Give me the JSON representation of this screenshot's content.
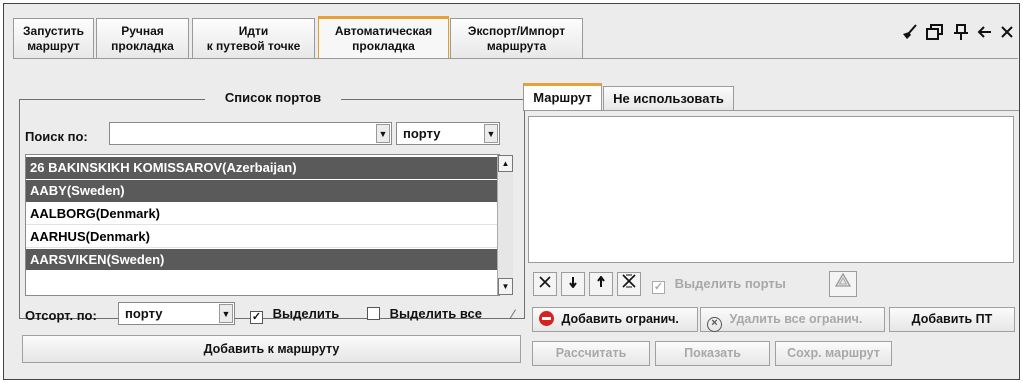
{
  "tabs": [
    {
      "label": "Запустить\nмаршрут"
    },
    {
      "label": "Ручная\nпрокладка"
    },
    {
      "label": "Идти\nк путевой точке"
    },
    {
      "label": "Автоматическая\nпрокладка"
    },
    {
      "label": "Экспорт/Импорт\nмаршрута"
    }
  ],
  "toolbar_icons": [
    "broom-icon",
    "restore-window-icon",
    "pin-icon",
    "back-arrow-icon",
    "close-icon"
  ],
  "ports_panel": {
    "title": "Список портов",
    "search_label": "Поиск по:",
    "search_value": "",
    "search_by_value": "порту",
    "ports": [
      {
        "name": "26 BAKINSKIKH KOMISSAROV(Azerbaijan)",
        "highlighted": true
      },
      {
        "name": "AABY(Sweden)",
        "highlighted": true
      },
      {
        "name": "AALBORG(Denmark)",
        "highlighted": false
      },
      {
        "name": "AARHUS(Denmark)",
        "highlighted": false
      },
      {
        "name": "AARSVIKEN(Sweden)",
        "highlighted": true
      }
    ],
    "sort_label": "Отсорт. по:",
    "sort_value": "порту",
    "highlight_label": "Выделить",
    "highlight_checked": true,
    "highlight_all_label": "Выделить все",
    "highlight_all_checked": false,
    "add_to_route_label": "Добавить к маршруту"
  },
  "route_panel": {
    "tabs": [
      {
        "label": "Маршрут"
      },
      {
        "label": "Не использовать"
      }
    ],
    "show_ports_label": "Выделить порты",
    "show_ports_checked": true,
    "add_restriction_label": "Добавить огранич.",
    "remove_all_restrictions_label": "Удалить все огранич.",
    "add_waypoint_label": "Добавить ПТ",
    "calculate_label": "Рассчитать",
    "show_label": "Показать",
    "save_route_label": "Сохр. маршрут"
  },
  "colors": {
    "active_tab_accent": "#e8a13a",
    "highlight_row": "#5a5a5a",
    "stop_icon": "#d92020"
  }
}
